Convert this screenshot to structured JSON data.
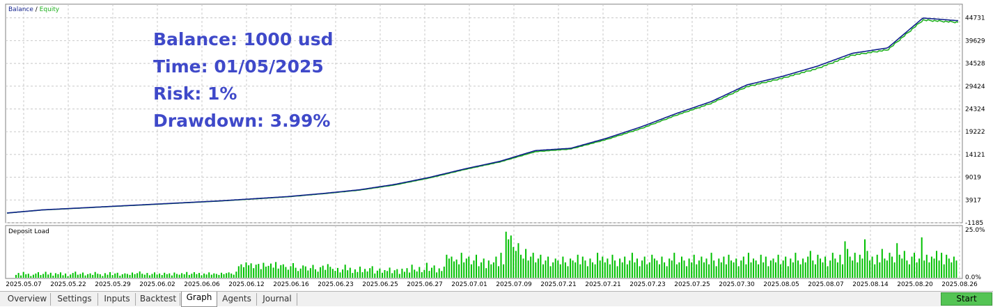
{
  "legend": {
    "balance": "Balance",
    "separator": " / ",
    "equity": "Equity"
  },
  "overlay": {
    "balance": "Balance: 1000 usd",
    "time": "Time: 01/05/2025",
    "risk": "Risk: 1%",
    "drawdown": "Drawdown: 3.99%"
  },
  "deposit_pane": {
    "title": "Deposit Load"
  },
  "tabs": [
    {
      "label": "Overview",
      "active": false
    },
    {
      "label": "Settings",
      "active": false
    },
    {
      "label": "Inputs",
      "active": false
    },
    {
      "label": "Backtest",
      "active": false
    },
    {
      "label": "Graph",
      "active": true
    },
    {
      "label": "Agents",
      "active": false
    },
    {
      "label": "Journal",
      "active": false
    }
  ],
  "start_button": {
    "label": "Start"
  },
  "colors": {
    "balance": "#0f1f8c",
    "equity": "#20b020",
    "deposit": "#00c000",
    "grid": "#c8c8c8",
    "overlay_text": "#3f49c9"
  },
  "chart_data": [
    {
      "type": "line",
      "series": [
        {
          "name": "Balance",
          "values": [
            1000,
            1700,
            2100,
            2500,
            2900,
            3300,
            3700,
            4200,
            4700,
            5400,
            6200,
            7400,
            9000,
            10900,
            12600,
            15000,
            15500,
            17700,
            20300,
            23300,
            26000,
            29700,
            31600,
            33900,
            36800,
            38000,
            44700,
            44100
          ]
        },
        {
          "name": "Equity",
          "values": [
            990,
            1690,
            2080,
            2490,
            2880,
            3280,
            3680,
            4170,
            4670,
            5360,
            6150,
            7300,
            8900,
            10800,
            12500,
            14800,
            15400,
            17500,
            20000,
            23000,
            25700,
            29400,
            31300,
            33500,
            36500,
            37700,
            44400,
            43900
          ]
        }
      ],
      "x_ticks": [
        "2025.05.07",
        "2025.05.22",
        "2025.05.29",
        "2025.06.02",
        "2025.06.06",
        "2025.06.12",
        "2025.06.16",
        "2025.06.23",
        "2025.06.25",
        "2025.06.27",
        "2025.07.01",
        "2025.07.09",
        "2025.07.21",
        "2025.07.21",
        "2025.07.23",
        "2025.07.25",
        "2025.07.30",
        "2025.08.05",
        "2025.08.07",
        "2025.08.14",
        "2025.08.20",
        "2025.08.26"
      ],
      "y_ticks": [
        44731,
        39629,
        34528,
        29424,
        24324,
        19222,
        14121,
        9019,
        3917,
        -1185
      ],
      "ylim": [
        -1185,
        47800
      ]
    },
    {
      "type": "bar",
      "title": "Deposit Load",
      "y_ticks": [
        "25.0%",
        "0.0%"
      ],
      "ylim": [
        0,
        25
      ],
      "values": [
        1.5,
        2.5,
        1.2,
        3,
        1.8,
        2.1,
        0.9,
        1.6,
        2.2,
        2.9,
        1.4,
        2.0,
        3.1,
        1.7,
        2.6,
        1.1,
        2.4,
        1.9,
        2.8,
        1.3,
        2.2,
        0.8,
        1.7,
        2.5,
        3.2,
        1.6,
        2.0,
        2.7,
        1.2,
        1.9,
        2.3,
        1.5,
        3.0,
        2.1,
        1.8,
        0.9,
        2.4,
        1.6,
        2.9,
        1.4,
        2.2,
        2.6,
        1.1,
        1.8,
        2.3,
        2.0,
        1.5,
        2.7,
        1.9,
        2.4,
        3.3,
        2.1,
        1.6,
        2.5,
        1.3,
        2.0,
        2.8,
        1.7,
        2.2,
        1.4,
        2.6,
        1.9,
        2.3,
        1.2,
        2.7,
        2.0,
        1.6,
        2.4,
        1.8,
        3.0,
        1.5,
        2.1,
        2.9,
        1.9,
        2.5,
        1.3,
        2.2,
        1.7,
        2.8,
        1.6,
        2.3,
        2.0,
        1.5,
        2.6,
        1.9,
        2.4,
        2.8,
        2.2,
        1.6,
        3.2,
        6.0,
        7.0,
        5.5,
        8.0,
        6.5,
        7.5,
        5.0,
        6.8,
        7.2,
        4.5,
        7.8,
        5.8,
        6.2,
        7.4,
        5.3,
        8.2,
        4.8,
        6.6,
        7.0,
        5.6,
        4.2,
        6.0,
        7.6,
        5.2,
        3.5,
        4.8,
        6.4,
        5.9,
        3.8,
        5.0,
        6.7,
        4.4,
        3.2,
        5.5,
        6.3,
        4.1,
        7.1,
        5.7,
        4.6,
        3.6,
        5.1,
        2.8,
        4.3,
        6.8,
        3.9,
        5.2,
        2.5,
        4.4,
        3.0,
        5.8,
        2.9,
        4.6,
        3.3,
        5.0,
        6.0,
        2.2,
        3.7,
        4.8,
        2.6,
        4.0,
        3.5,
        5.3,
        2.4,
        3.9,
        4.5,
        2.0,
        4.7,
        3.1,
        5.0,
        2.7,
        6.8,
        4.2,
        3.3,
        5.6,
        2.9,
        4.1,
        7.8,
        3.6,
        5.2,
        6.4,
        2.8,
        4.9,
        3.5,
        5.8,
        12,
        10,
        11,
        8.5,
        9.5,
        7,
        13,
        8,
        10,
        11,
        7,
        9,
        12,
        6,
        8,
        10,
        5,
        9,
        7,
        8,
        11,
        6,
        13,
        7,
        24,
        20,
        22,
        16,
        14,
        18,
        12,
        10,
        15,
        9,
        11,
        13,
        8,
        10,
        12,
        7,
        9,
        11,
        6,
        8,
        10,
        9,
        7,
        11,
        8,
        6,
        10,
        9,
        8,
        12,
        7,
        11,
        9,
        6,
        10,
        8,
        7,
        13,
        9,
        11,
        8,
        10,
        7,
        12,
        9,
        6,
        10,
        8,
        11,
        7,
        9,
        13,
        8,
        10,
        6,
        9,
        11,
        7,
        8,
        12,
        10,
        9,
        7,
        11,
        8,
        6,
        10,
        9,
        13,
        7,
        8,
        11,
        9,
        6,
        10,
        8,
        12,
        7,
        9,
        11,
        8,
        10,
        7,
        13,
        9,
        6,
        10,
        8,
        11,
        7,
        12,
        9,
        8,
        10,
        6,
        9,
        11,
        7,
        13,
        8,
        10,
        9,
        7,
        12,
        8,
        11,
        6,
        9,
        10,
        8,
        12,
        7,
        9,
        11,
        6,
        10,
        8,
        13,
        9,
        7,
        10,
        8,
        11,
        14,
        9,
        7,
        12,
        10,
        8,
        11,
        6,
        9,
        13,
        10,
        8,
        12,
        7,
        19,
        15,
        11,
        9,
        13,
        8,
        12,
        10,
        20,
        14,
        9,
        11,
        7,
        12,
        8,
        15,
        10,
        9,
        13,
        11,
        8,
        18,
        12,
        10,
        14,
        9,
        7,
        11,
        13,
        8,
        10,
        21,
        9,
        12,
        8,
        11,
        10,
        14,
        9,
        13,
        7,
        12,
        10,
        8,
        11,
        9
      ]
    }
  ]
}
